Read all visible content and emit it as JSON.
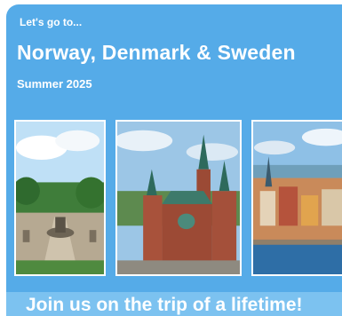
{
  "header": {
    "kicker": "Let's go to...",
    "title": "Norway, Denmark & Sweden",
    "subtitle": "Summer 2025"
  },
  "footer": {
    "cta": "Join us on the trip of a lifetime!"
  },
  "colors": {
    "card_background": "#55abe8",
    "banner_background": "#7cc2f0",
    "text": "#ffffff"
  }
}
